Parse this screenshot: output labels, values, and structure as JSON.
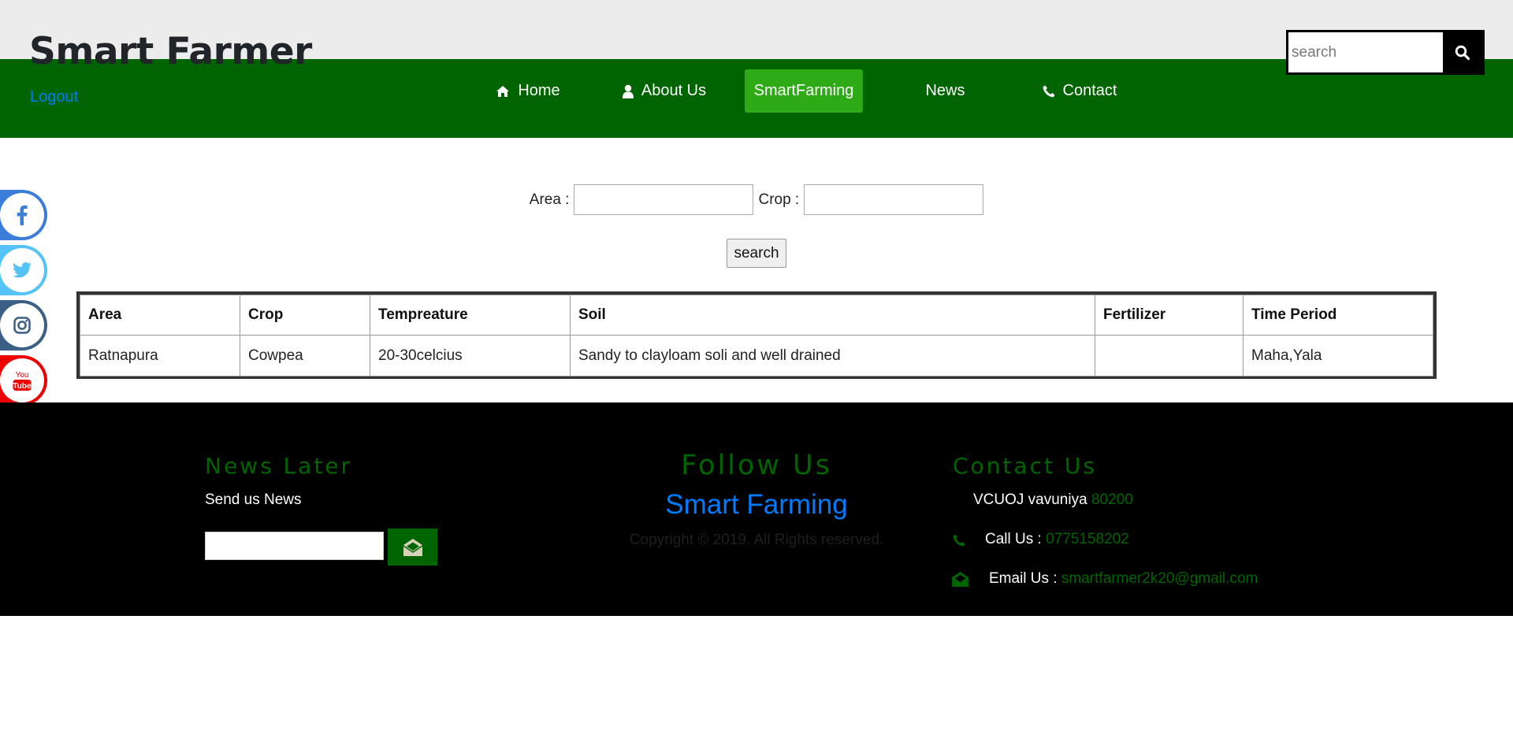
{
  "header": {
    "brand": "Smart Farmer",
    "logout": "Logout",
    "search_placeholder": "search"
  },
  "nav": {
    "items": [
      {
        "label": "Home",
        "icon": "home-icon"
      },
      {
        "label": "About Us",
        "icon": "user-icon"
      },
      {
        "label": "SmartFarming",
        "active": true
      },
      {
        "label": "News"
      },
      {
        "label": "Contact",
        "icon": "phone-icon"
      }
    ]
  },
  "social": [
    {
      "name": "facebook-icon",
      "color": "#3b7dd8"
    },
    {
      "name": "twitter-icon",
      "color": "#55c3f5"
    },
    {
      "name": "instagram-icon",
      "color": "#3b5f85"
    },
    {
      "name": "youtube-icon",
      "color": "#ee0000"
    }
  ],
  "form": {
    "area_label": "Area :",
    "area_value": "",
    "crop_label": "Crop :",
    "crop_value": "",
    "search_button": "search"
  },
  "table": {
    "headers": [
      "Area",
      "Crop",
      "Tempreature",
      "Soil",
      "Fertilizer",
      "Time Period"
    ],
    "rows": [
      [
        "Ratnapura",
        "Cowpea",
        "20-30celcius",
        "Sandy to clayloam soli and well drained",
        "",
        "Maha,Yala"
      ]
    ]
  },
  "footer": {
    "news_title": "News Later",
    "news_subtitle": "Send us News",
    "newsletter_value": "",
    "follow_title": "Follow Us",
    "brand_link": "Smart Farming",
    "copyright": "Copyright © 2019. All Rights reserved.",
    "contact_title": "Contact Us",
    "address_text": "VCUOJ vavuniya",
    "address_code": "80200",
    "call_label": "Call Us :",
    "call_number": "0775158202",
    "email_label": "Email Us :",
    "email_address": "smartfarmer2k20@gmail.com"
  },
  "colors": {
    "nav_green": "#006400",
    "active_green": "#2eaa17",
    "link_blue": "#007bff",
    "footer_bg": "#000000"
  }
}
